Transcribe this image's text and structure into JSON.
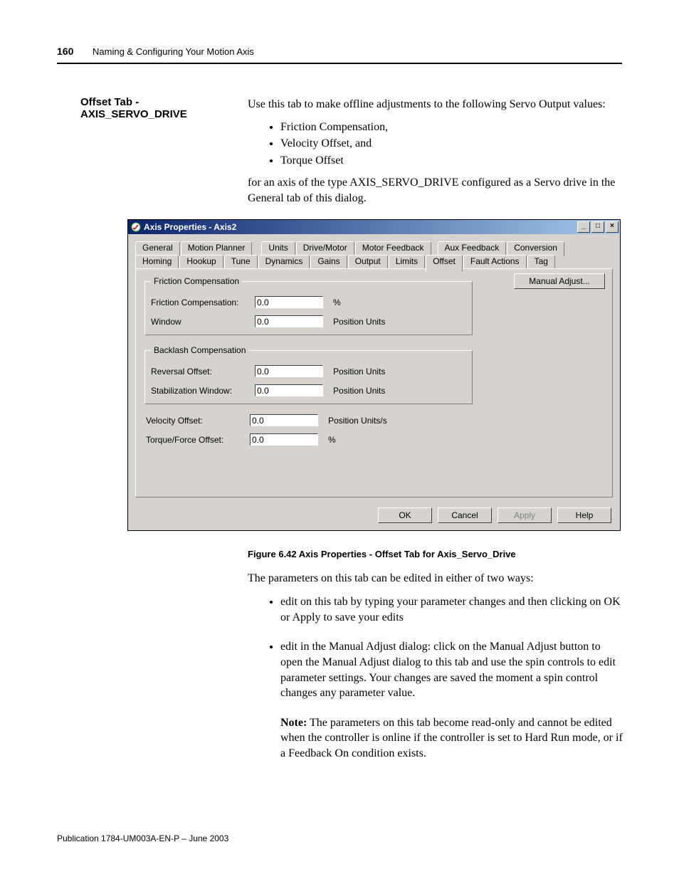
{
  "page": {
    "number": "160",
    "running_head": "Naming & Configuring Your Motion Axis",
    "footer": "Publication 1784-UM003A-EN-P – June 2003"
  },
  "section": {
    "title": "Offset Tab - AXIS_SERVO_DRIVE",
    "intro": "Use this tab to make offline adjustments to the following Servo Output values:",
    "bullets": {
      "b1": "Friction Compensation,",
      "b2": "Velocity Offset, and",
      "b3": "Torque Offset"
    },
    "post_intro": "for an axis of the type AXIS_SERVO_DRIVE configured as a Servo drive in the General tab of this dialog."
  },
  "dialog": {
    "title": "Axis Properties - Axis2",
    "winbtn": {
      "min": "_",
      "max": "□",
      "close": "×"
    },
    "tabs_top": {
      "t0": "General",
      "t1": "Motion Planner",
      "t2": "Units",
      "t3": "Drive/Motor",
      "t4": "Motor Feedback",
      "t5": "Aux Feedback",
      "t6": "Conversion"
    },
    "tabs_bottom": {
      "b0": "Homing",
      "b1": "Hookup",
      "b2": "Tune",
      "b3": "Dynamics",
      "b4": "Gains",
      "b5": "Output",
      "b6": "Limits",
      "b7": "Offset",
      "b8": "Fault Actions",
      "b9": "Tag"
    },
    "manual_adjust": "Manual Adjust...",
    "groups": {
      "friction": {
        "legend": "Friction Compensation",
        "row1_label": "Friction Compensation:",
        "row1_value": "0.0",
        "row1_unit": "%",
        "row2_label": "Window",
        "row2_value": "0.0",
        "row2_unit": "Position Units"
      },
      "backlash": {
        "legend": "Backlash Compensation",
        "row1_label": "Reversal Offset:",
        "row1_value": "0.0",
        "row1_unit": "Position Units",
        "row2_label": "Stabilization Window:",
        "row2_value": "0.0",
        "row2_unit": "Position Units"
      },
      "loose": {
        "vel_label": "Velocity Offset:",
        "vel_value": "0.0",
        "vel_unit": "Position Units/s",
        "torque_label": "Torque/Force Offset:",
        "torque_value": "0.0",
        "torque_unit": "%"
      }
    },
    "buttons": {
      "ok": "OK",
      "cancel": "Cancel",
      "apply": "Apply",
      "help": "Help"
    }
  },
  "figure_caption": "Figure 6.42 Axis Properties - Offset Tab for Axis_Servo_Drive",
  "after": {
    "p1": "The parameters on this tab can be edited in either of two ways:",
    "li1": "edit on this tab by typing your parameter changes and then clicking on OK or Apply to save your edits",
    "li2": "edit in the Manual Adjust dialog: click on the Manual Adjust button to open the Manual Adjust dialog to this tab and use the spin controls to edit parameter settings. Your changes are saved the moment a spin control changes any parameter value.",
    "note_label": "Note:",
    "note_body": " The parameters on this tab become read-only and cannot be edited when the controller is online if the controller is set to Hard Run mode, or if a Feedback On condition exists."
  }
}
